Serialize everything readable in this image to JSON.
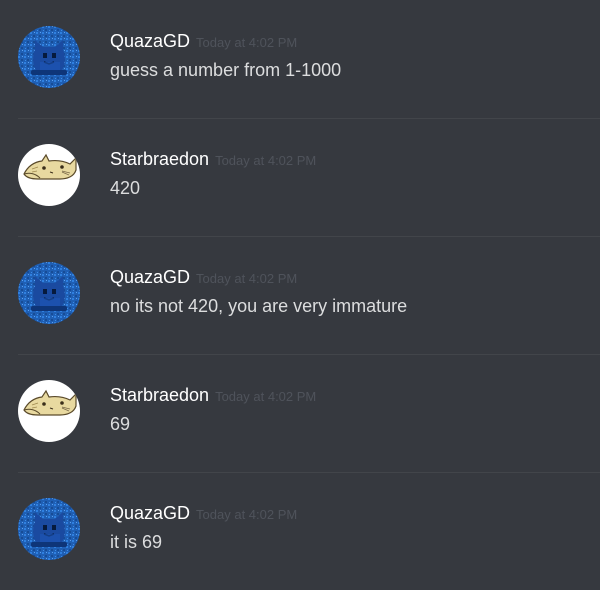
{
  "colors": {
    "background": "#36393f",
    "username": "#ffffff",
    "timestamp": "#4f535b",
    "message_text": "#dcddde",
    "divider": "#42454a"
  },
  "messages": [
    {
      "author": "QuazaGD",
      "avatar_icon": "blue-cat-avatar",
      "timestamp": "Today at 4:02 PM",
      "text": "guess a number from 1-1000"
    },
    {
      "author": "Starbraedon",
      "avatar_icon": "cat-sketch-avatar",
      "timestamp": "Today at 4:02 PM",
      "text": "420"
    },
    {
      "author": "QuazaGD",
      "avatar_icon": "blue-cat-avatar",
      "timestamp": "Today at 4:02 PM",
      "text": "no its not 420, you are very immature"
    },
    {
      "author": "Starbraedon",
      "avatar_icon": "cat-sketch-avatar",
      "timestamp": "Today at 4:02 PM",
      "text": "69"
    },
    {
      "author": "QuazaGD",
      "avatar_icon": "blue-cat-avatar",
      "timestamp": "Today at 4:02 PM",
      "text": "it is 69"
    }
  ]
}
